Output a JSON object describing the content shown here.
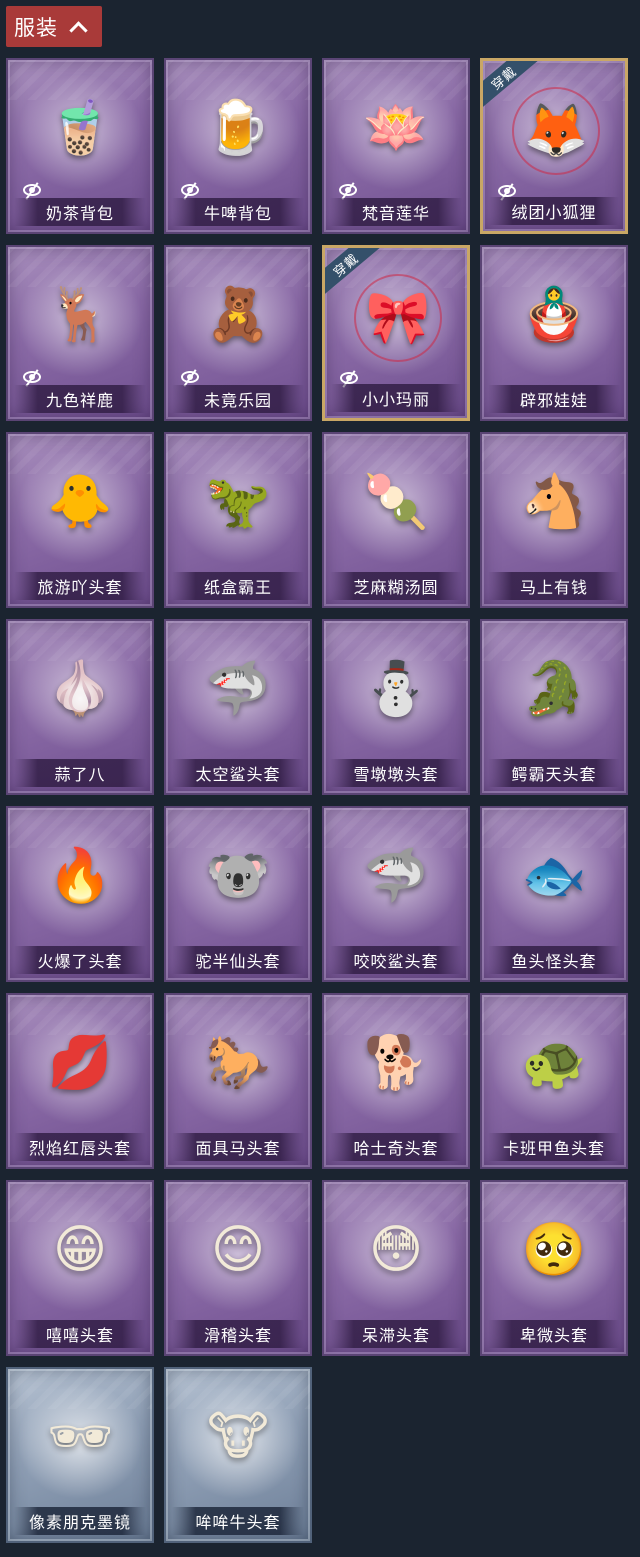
{
  "header": {
    "title": "服装"
  },
  "items": [
    {
      "name": "奶茶背包",
      "icon": "🧋",
      "hidden": true,
      "equipped": false,
      "rare": false
    },
    {
      "name": "牛啤背包",
      "icon": "🍺",
      "hidden": true,
      "equipped": false,
      "rare": false
    },
    {
      "name": "梵音莲华",
      "icon": "🪷",
      "hidden": true,
      "equipped": false,
      "rare": false
    },
    {
      "name": "绒团小狐狸",
      "icon": "🦊",
      "hidden": true,
      "equipped": true,
      "rare": false
    },
    {
      "name": "九色祥鹿",
      "icon": "🦌",
      "hidden": true,
      "equipped": false,
      "rare": false
    },
    {
      "name": "未竟乐园",
      "icon": "🧸",
      "hidden": true,
      "equipped": false,
      "rare": false
    },
    {
      "name": "小小玛丽",
      "icon": "🎀",
      "hidden": true,
      "equipped": true,
      "rare": false
    },
    {
      "name": "辟邪娃娃",
      "icon": "🪆",
      "hidden": false,
      "equipped": false,
      "rare": false
    },
    {
      "name": "旅游吖头套",
      "icon": "🐥",
      "hidden": false,
      "equipped": false,
      "rare": false
    },
    {
      "name": "纸盒霸王",
      "icon": "🦖",
      "hidden": false,
      "equipped": false,
      "rare": false
    },
    {
      "name": "芝麻糊汤圆",
      "icon": "🍡",
      "hidden": false,
      "equipped": false,
      "rare": false
    },
    {
      "name": "马上有钱",
      "icon": "🐴",
      "hidden": false,
      "equipped": false,
      "rare": false
    },
    {
      "name": "蒜了八",
      "icon": "🧄",
      "hidden": false,
      "equipped": false,
      "rare": false
    },
    {
      "name": "太空鲨头套",
      "icon": "🦈",
      "hidden": false,
      "equipped": false,
      "rare": false
    },
    {
      "name": "雪墩墩头套",
      "icon": "⛄",
      "hidden": false,
      "equipped": false,
      "rare": false
    },
    {
      "name": "鳄霸天头套",
      "icon": "🐊",
      "hidden": false,
      "equipped": false,
      "rare": false
    },
    {
      "name": "火爆了头套",
      "icon": "🔥",
      "hidden": false,
      "equipped": false,
      "rare": false
    },
    {
      "name": "驼半仙头套",
      "icon": "🐨",
      "hidden": false,
      "equipped": false,
      "rare": false
    },
    {
      "name": "咬咬鲨头套",
      "icon": "🦈",
      "hidden": false,
      "equipped": false,
      "rare": false
    },
    {
      "name": "鱼头怪头套",
      "icon": "🐟",
      "hidden": false,
      "equipped": false,
      "rare": false
    },
    {
      "name": "烈焰红唇头套",
      "icon": "💋",
      "hidden": false,
      "equipped": false,
      "rare": false
    },
    {
      "name": "面具马头套",
      "icon": "🐎",
      "hidden": false,
      "equipped": false,
      "rare": false
    },
    {
      "name": "哈士奇头套",
      "icon": "🐕",
      "hidden": false,
      "equipped": false,
      "rare": false
    },
    {
      "name": "卡班甲鱼头套",
      "icon": "🐢",
      "hidden": false,
      "equipped": false,
      "rare": false
    },
    {
      "name": "嘻嘻头套",
      "icon": "😁",
      "hidden": false,
      "equipped": false,
      "rare": false
    },
    {
      "name": "滑稽头套",
      "icon": "😊",
      "hidden": false,
      "equipped": false,
      "rare": false
    },
    {
      "name": "呆滞头套",
      "icon": "😳",
      "hidden": false,
      "equipped": false,
      "rare": false
    },
    {
      "name": "卑微头套",
      "icon": "🥺",
      "hidden": false,
      "equipped": false,
      "rare": false
    },
    {
      "name": "像素朋克墨镜",
      "icon": "🕶",
      "hidden": false,
      "equipped": false,
      "rare": true
    },
    {
      "name": "哞哞牛头套",
      "icon": "🐮",
      "hidden": false,
      "equipped": false,
      "rare": true
    }
  ],
  "equipped_badge": "穿戴",
  "colors": {
    "background": "#1b2430",
    "header_tab": "#a93a39",
    "equipped_border": "#c9a765"
  }
}
